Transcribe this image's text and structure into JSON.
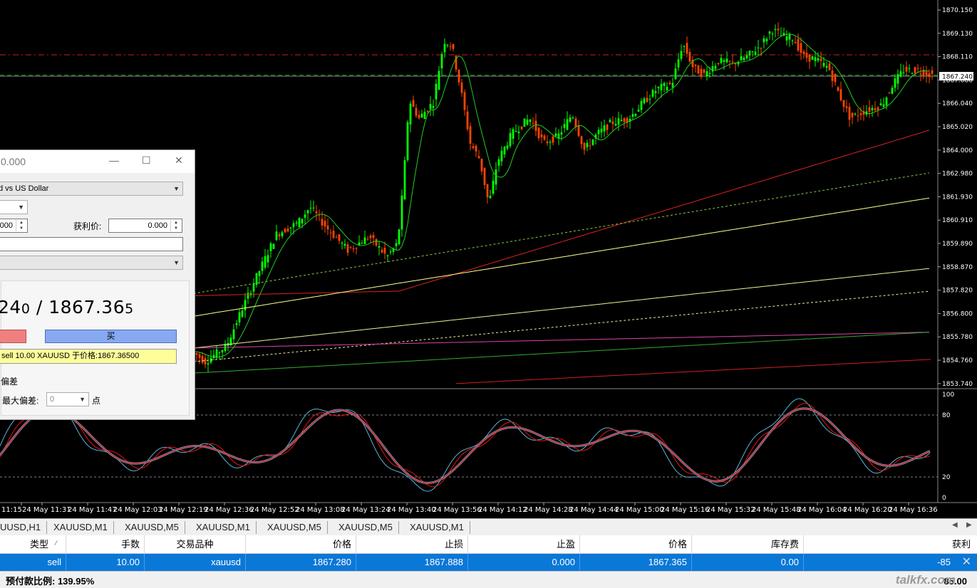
{
  "chart": {
    "price_axis": [
      "1870.150",
      "1869.130",
      "1868.110",
      "1867.080",
      "1866.040",
      "1865.020",
      "1864.000",
      "1862.980",
      "1861.930",
      "1860.910",
      "1859.890",
      "1858.870",
      "1857.820",
      "1856.800",
      "1855.780",
      "1854.760",
      "1853.740"
    ],
    "current_price_tag": "1867.240",
    "oscillator_axis": [
      "100",
      "80",
      "20",
      "0"
    ],
    "time_axis": [
      "11:15",
      "24 May 11:31",
      "24 May 11:47",
      "24 May 12:03",
      "24 May 12:19",
      "24 May 12:36",
      "24 May 12:52",
      "24 May 13:08",
      "24 May 13:24",
      "24 May 13:40",
      "24 May 13:56",
      "24 May 14:12",
      "24 May 14:28",
      "24 May 14:44",
      "24 May 15:00",
      "24 May 15:16",
      "24 May 15:32",
      "24 May 15:48",
      "24 May 16:04",
      "24 May 16:20",
      "24 May 16:36"
    ],
    "colors": {
      "bull": "#00ff00",
      "bear": "#ff4500",
      "ma_green": "#22cc22",
      "ma_red": "#dd2222",
      "ma_yellow": "#ffff88",
      "stoch_main": "#5ab4d8",
      "stoch_signal": "#ee1111"
    }
  },
  "dialog": {
    "title": "0.000",
    "symbol": "d vs US Dollar",
    "sl_value": "000",
    "tp_label": "获利价:",
    "tp_value": "0.000",
    "bid_head": "24",
    "bid_tail": "0",
    "separator": " / ",
    "ask_head": "1867.36",
    "ask_tail": "5",
    "buy_label": "买",
    "exec_message": "sell 10.00 XAUUSD 于价格:1867.36500",
    "deviation_label": "偏差",
    "max_deviation_label": "最大偏差:",
    "max_deviation_value": "0",
    "points_label": "点"
  },
  "tabs": [
    "UUSD,H1",
    "XAUUSD,M1",
    "XAUUSD,M5",
    "XAUUSD,M1",
    "XAUUSD,M5",
    "XAUUSD,M5",
    "XAUUSD,M1"
  ],
  "table": {
    "headers": [
      "类型",
      "手数",
      "交易品种",
      "价格",
      "止损",
      "止盈",
      "价格",
      "库存费",
      "获利"
    ],
    "row": [
      "sell",
      "10.00",
      "xauusd",
      "1867.280",
      "1867.888",
      "0.000",
      "1867.365",
      "0.00",
      "-85"
    ]
  },
  "status": {
    "margin_level": "预付款比例: 139.95%",
    "partial_profit": "85.00",
    "watermark": "talkfx.com"
  }
}
